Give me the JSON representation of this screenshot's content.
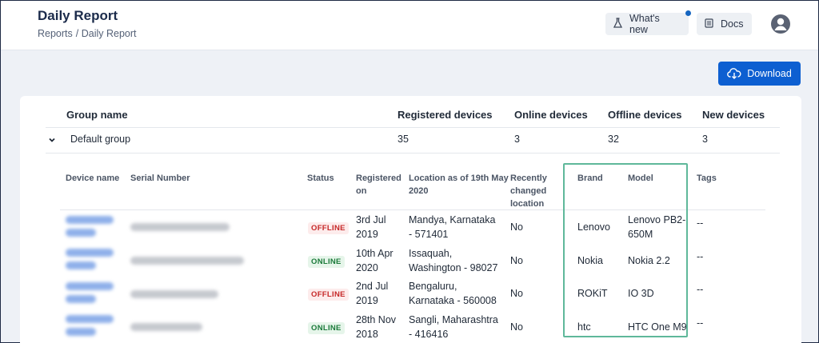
{
  "header": {
    "title": "Daily Report",
    "breadcrumb": [
      "Reports",
      "/ Daily Report"
    ],
    "whats_new": "What's new",
    "docs": "Docs"
  },
  "download_label": "Download",
  "group_table": {
    "columns": [
      "Group name",
      "Registered devices",
      "Online devices",
      "Offline devices",
      "New devices"
    ],
    "row": {
      "name": "Default group",
      "registered": "35",
      "online": "3",
      "offline": "32",
      "new": "3"
    }
  },
  "device_table": {
    "columns": {
      "device_name": "Device name",
      "serial": "Serial Number",
      "status": "Status",
      "registered_on": [
        "Registered",
        "on"
      ],
      "location": [
        "Location as of 19th May",
        "2020"
      ],
      "changed": [
        "Recently",
        "changed",
        "location"
      ],
      "brand": "Brand",
      "model": "Model",
      "tags": "Tags"
    },
    "rows": [
      {
        "status": "OFFLINE",
        "registered": [
          "3rd Jul",
          "2019"
        ],
        "location": [
          "Mandya, Karnataka",
          "- 571401"
        ],
        "changed": "No",
        "brand": "Lenovo",
        "model": [
          "Lenovo PB2-",
          "650M"
        ],
        "tags": "--"
      },
      {
        "status": "ONLINE",
        "registered": [
          "10th Apr",
          "2020"
        ],
        "location": [
          "Issaquah,",
          "Washington - 98027"
        ],
        "changed": "No",
        "brand": "Nokia",
        "model": [
          "Nokia 2.2",
          ""
        ],
        "tags": "--"
      },
      {
        "status": "OFFLINE",
        "registered": [
          "2nd Jul",
          "2019"
        ],
        "location": [
          "Bengaluru,",
          "Karnataka - 560008"
        ],
        "changed": "No",
        "brand": "ROKiT",
        "model": [
          "IO 3D",
          ""
        ],
        "tags": "--"
      },
      {
        "status": "ONLINE",
        "registered": [
          "28th Nov",
          "2018"
        ],
        "location": [
          "Sangli, Maharashtra",
          "- 416416"
        ],
        "changed": "No",
        "brand": "htc",
        "model": [
          "HTC One M9",
          ""
        ],
        "tags": "--"
      }
    ]
  },
  "colors": {
    "accent": "#0d5fd1",
    "highlight": "#5fb89a",
    "offline": "#c62828",
    "online": "#1b7a3a"
  }
}
